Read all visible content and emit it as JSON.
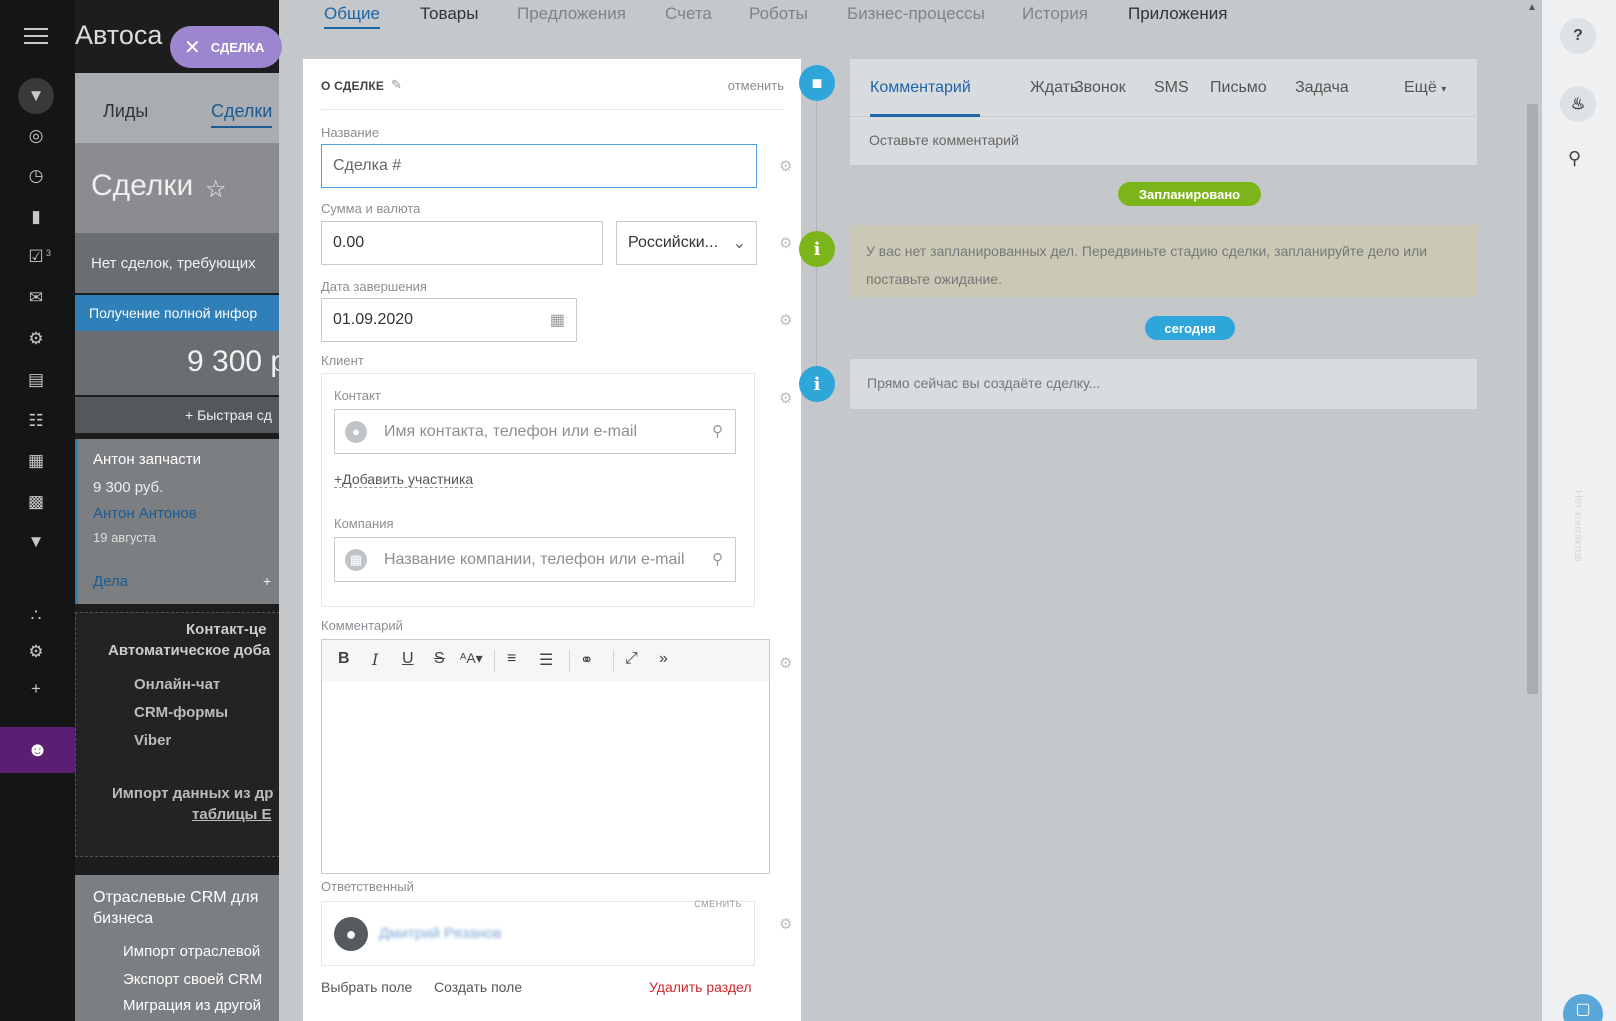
{
  "app": {
    "title": "Автоса",
    "deal_chip": "СДЕЛКА"
  },
  "leftbar": {
    "badge_tasks": "3"
  },
  "background": {
    "tabs": [
      "Лиды",
      "Сделки"
    ],
    "heading": "Сделки",
    "no_deals": "Нет сделок, требующих",
    "stage": "Получение полной инфор",
    "sum": "9 300 р",
    "quick_add": "+  Быстрая сд",
    "card": {
      "title": "Антон запчасти",
      "amount": "9 300 руб.",
      "contact": "Антон Антонов",
      "date": "19 августа",
      "activities": "Дела",
      "plus": "+"
    },
    "contact_center": {
      "title": "Контакт-це",
      "subtitle": "Автоматическое доба",
      "channels": [
        "Онлайн-чат",
        "CRM-формы",
        "Viber"
      ],
      "import": "Импорт данных из др",
      "import_link": "таблицы E"
    },
    "industry": {
      "title": "Отраслевые CRM для",
      "title2": "бизнеса",
      "items": [
        "Импорт отраслевой",
        "Экспорт своей CRM",
        "Миграция из другой"
      ]
    }
  },
  "tabs": [
    "Общие",
    "Товары",
    "Предложения",
    "Счета",
    "Роботы",
    "Бизнес-процессы",
    "История",
    "Приложения"
  ],
  "form": {
    "section_title": "О СДЕЛКЕ",
    "cancel": "отменить",
    "name_label": "Название",
    "name_placeholder": "Сделка #",
    "sum_label": "Сумма и валюта",
    "sum_value": "0.00",
    "currency": "Российски...",
    "date_label": "Дата завершения",
    "date_value": "01.09.2020",
    "client_label": "Клиент",
    "contact_label": "Контакт",
    "contact_placeholder": "Имя контакта, телефон или e-mail",
    "add_participant": "+Добавить участника",
    "company_label": "Компания",
    "company_placeholder": "Название компании, телефон или e-mail",
    "comment_label": "Комментарий",
    "responsible_label": "Ответственный",
    "change": "СМЕНИТЬ",
    "responsible_name": "Дмитрий Рязанов",
    "footer": {
      "select_field": "Выбрать поле",
      "create_field": "Создать поле",
      "delete_section": "Удалить раздел"
    }
  },
  "timeline": {
    "activity_tabs": [
      "Комментарий",
      "Ждать",
      "Звонок",
      "SMS",
      "Письмо",
      "Задача"
    ],
    "more": "Ещё",
    "comment_placeholder": "Оставьте комментарий",
    "planned": "Запланировано",
    "no_planned": "У вас нет запланированных дел. Передвиньте стадию сделки, запланируйте дело или поставьте ожидание.",
    "today": "сегодня",
    "creating": "Прямо сейчас вы создаёте сделку..."
  },
  "rightbar": {
    "vertical_text": "Нет контактов"
  },
  "colors": {
    "accent": "#1e65a8",
    "planned_pill": "#7bb51a",
    "today_pill": "#2fa6d9",
    "delete": "#d0282b"
  }
}
